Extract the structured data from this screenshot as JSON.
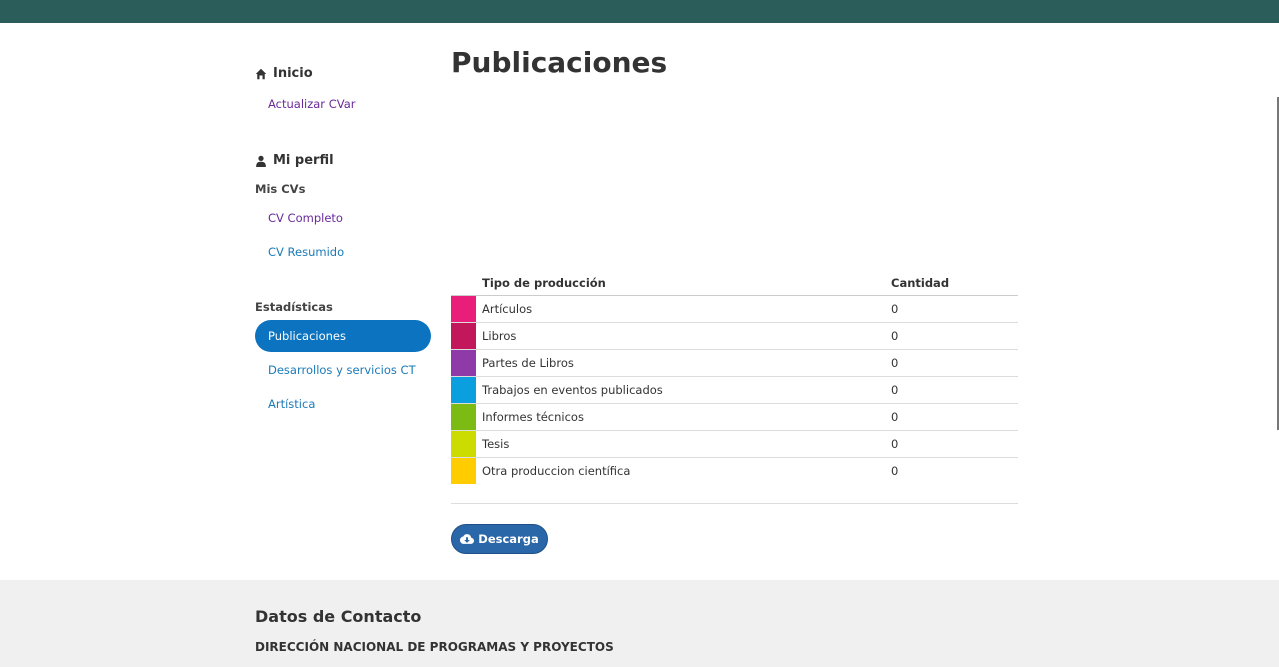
{
  "sidebar": {
    "inicio": "Inicio",
    "actualizar": "Actualizar CVar",
    "mi_perfil": "Mi perfil",
    "mis_cvs": "Mis CVs",
    "cv_completo": "CV Completo",
    "cv_resumido": "CV Resumido",
    "estadisticas": "Estadísticas",
    "publicaciones": "Publicaciones",
    "desarrollos": "Desarrollos y servicios CT",
    "artistica": "Artística"
  },
  "main": {
    "title": "Publicaciones",
    "table": {
      "col_tipo": "Tipo de producción",
      "col_cantidad": "Cantidad",
      "rows": [
        {
          "label": "Artículos",
          "count": "0",
          "color": "#e91e7a"
        },
        {
          "label": "Libros",
          "count": "0",
          "color": "#c2185b"
        },
        {
          "label": "Partes de Libros",
          "count": "0",
          "color": "#8e3aa8"
        },
        {
          "label": "Trabajos en eventos publicados",
          "count": "0",
          "color": "#0b9fe0"
        },
        {
          "label": "Informes técnicos",
          "count": "0",
          "color": "#7cbb13"
        },
        {
          "label": "Tesis",
          "count": "0",
          "color": "#cddc00"
        },
        {
          "label": "Otra produccion científica",
          "count": "0",
          "color": "#ffcc00"
        }
      ]
    },
    "download_label": "Descarga",
    "download_icon": "cloud-download-icon"
  },
  "footer": {
    "title": "Datos de Contacto",
    "org": "DIRECCIÓN NACIONAL DE PROGRAMAS Y PROYECTOS"
  },
  "colors": {
    "topbar": "#2b5d5a",
    "active_nav": "#0b73bf",
    "link": "#1a7ab8",
    "visited_link": "#6a2a9a",
    "button": "#2a67a9"
  }
}
